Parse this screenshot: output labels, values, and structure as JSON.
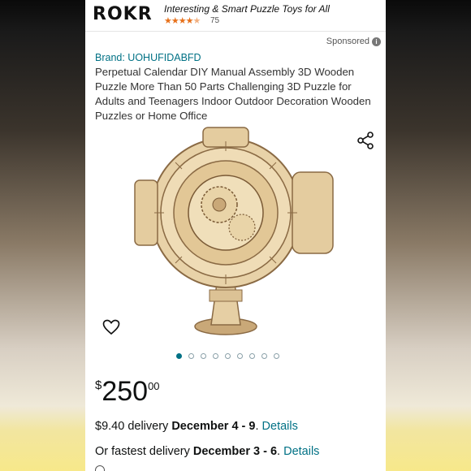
{
  "ad": {
    "logo": "ROKR",
    "tagline": "Interesting & Smart Puzzle Toys for All",
    "rating_stars": 4.5,
    "rating_count": "75"
  },
  "sponsored_label": "Sponsored",
  "product": {
    "brand": "Brand: UOHUFIDABFD",
    "title": "Perpetual Calendar DIY Manual Assembly 3D Wooden Puzzle More Than 50 Parts Challenging 3D Puzzle for Adults and Teenagers Indoor Outdoor Decoration Wooden Puzzles or Home Office",
    "image_count": 9,
    "active_image": 1
  },
  "price": {
    "symbol": "$",
    "whole": "250",
    "fraction": "00"
  },
  "delivery": {
    "standard_prefix": "$9.40 delivery",
    "standard_dates": "December 4 - 9",
    "standard_link": "Details",
    "fastest_prefix": "Or fastest delivery",
    "fastest_dates": "December 3 - 6",
    "fastest_link": "Details"
  },
  "colors": {
    "link": "#007185",
    "star": "#e7711b",
    "wood": "#e8d2a8"
  }
}
